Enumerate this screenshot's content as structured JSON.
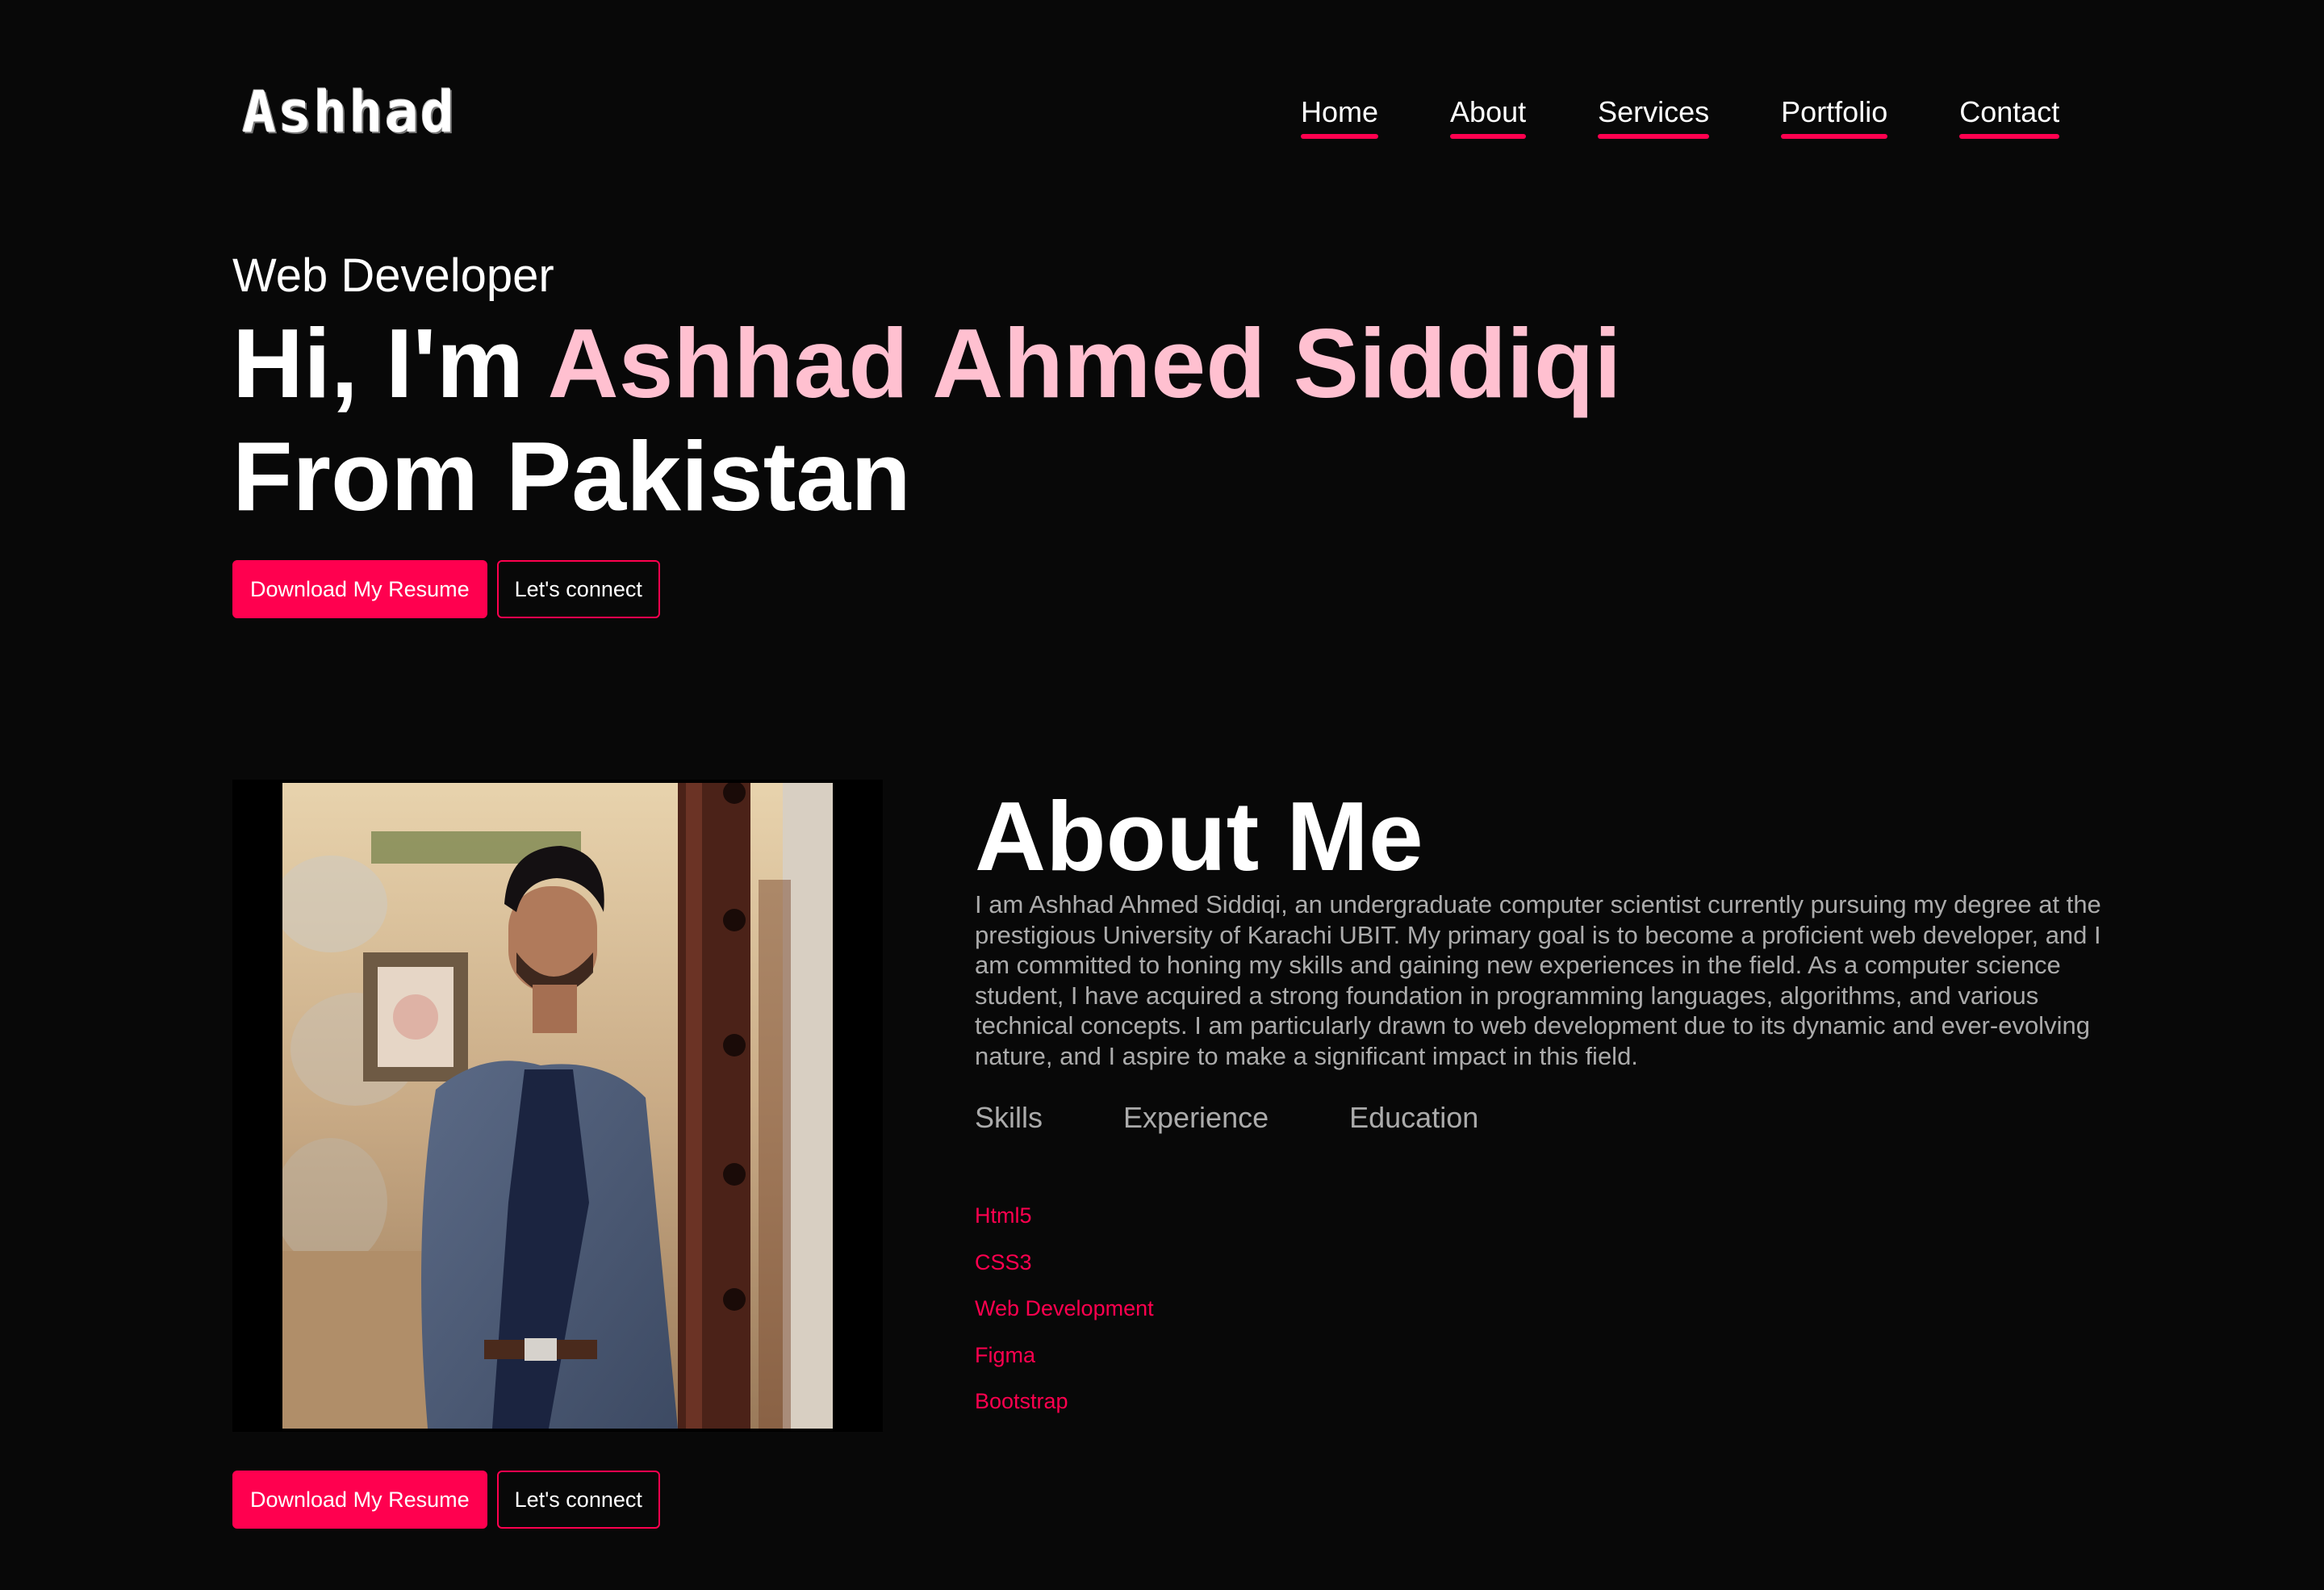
{
  "brand": {
    "logo": "Ashhad"
  },
  "nav": {
    "items": [
      {
        "label": "Home"
      },
      {
        "label": "About"
      },
      {
        "label": "Services"
      },
      {
        "label": "Portfolio"
      },
      {
        "label": "Contact"
      }
    ]
  },
  "hero": {
    "subtitle": "Web Developer",
    "greeting": "Hi, I'm ",
    "name": "Ashhad Ahmed Siddiqi",
    "origin": "From Pakistan",
    "primary_button": "Download My Resume",
    "secondary_button": "Let's connect"
  },
  "about": {
    "title": "About Me",
    "paragraph": "I am Ashhad Ahmed Siddiqi, an undergraduate computer scientist currently pursuing my degree at the prestigious University of Karachi UBIT. My primary goal is to become a proficient web developer, and I am committed to honing my skills and gaining new experiences in the field. As a computer science student, I have acquired a strong foundation in programming languages, algorithms, and various technical concepts. I am particularly drawn to web development due to its dynamic and ever-evolving nature, and I aspire to make a significant impact in this field.",
    "tabs": [
      {
        "label": "Skills"
      },
      {
        "label": "Experience"
      },
      {
        "label": "Education"
      }
    ],
    "skills": [
      {
        "label": "Html5"
      },
      {
        "label": "CSS3"
      },
      {
        "label": "Web Development"
      },
      {
        "label": "Figma"
      },
      {
        "label": "Bootstrap"
      }
    ],
    "primary_button": "Download My Resume",
    "secondary_button": "Let's connect"
  },
  "colors": {
    "accent": "#ff004f",
    "name_highlight": "#ffc0d0",
    "background": "#080808",
    "muted_text": "#ababab"
  }
}
